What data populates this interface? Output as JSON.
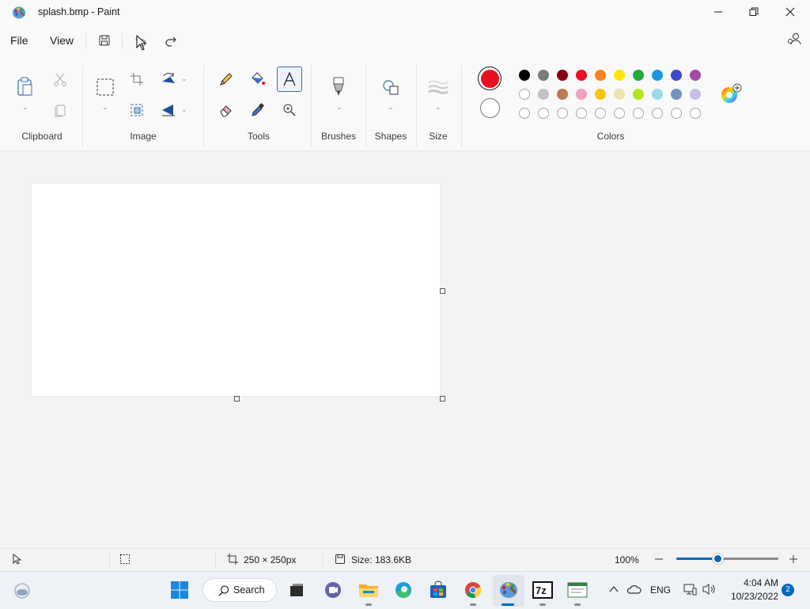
{
  "window": {
    "title": "splash.bmp - Paint",
    "icon": "paint-palette-icon",
    "controls": [
      "minimize-icon",
      "restore-icon",
      "close-icon"
    ]
  },
  "menu": {
    "file": "File",
    "view": "View"
  },
  "quick_actions": [
    "save-icon",
    "undo-icon",
    "redo-icon"
  ],
  "ribbon": {
    "groups": {
      "clipboard": "Clipboard",
      "image": "Image",
      "tools": "Tools",
      "brushes": "Brushes",
      "shapes": "Shapes",
      "size": "Size",
      "colors": "Colors"
    },
    "selected_tool": "text",
    "primary_color": "#e81123",
    "secondary_color": "#ffffff",
    "palette_row1": [
      "#000000",
      "#7a7a7a",
      "#880015",
      "#e81123",
      "#f7821b",
      "#ffe600",
      "#22a93a",
      "#1d96e0",
      "#3f48cc",
      "#a349a4"
    ],
    "palette_row2": [
      "#ffffff",
      "#c3c3c3",
      "#b97a57",
      "#f2a1c1",
      "#ffc20e",
      "#efe4b0",
      "#b5e61d",
      "#99d9ea",
      "#7092be",
      "#c8bfe7"
    ],
    "palette_row3_empty": 10
  },
  "status": {
    "canvas_size": "250 × 250px",
    "file_size": "Size: 183.6KB",
    "zoom": "100%",
    "zoom_fraction": 0.4
  },
  "taskbar": {
    "search_label": "Search",
    "language": "ENG",
    "time": "4:04 AM",
    "date": "10/23/2022",
    "notification_count": "2"
  }
}
